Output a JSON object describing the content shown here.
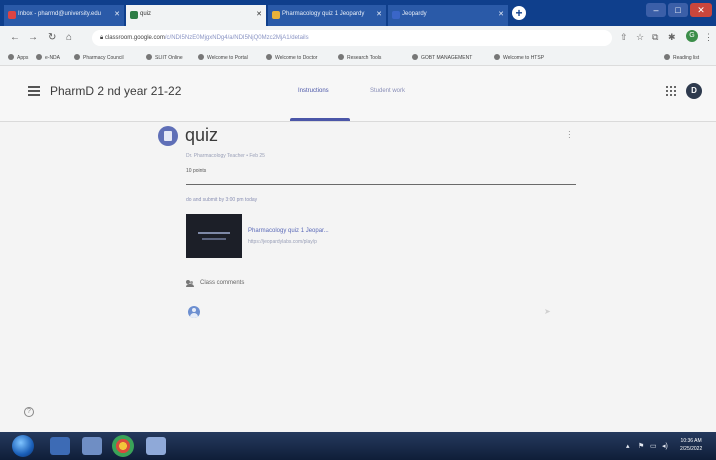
{
  "browser": {
    "tabs": [
      {
        "label": "Inbox - pharmd@university.edu",
        "active": false
      },
      {
        "label": "quiz",
        "active": true
      },
      {
        "label": "Pharmacology quiz 1 Jeopardy",
        "active": false
      },
      {
        "label": "Jeopardy",
        "active": false
      }
    ],
    "url": "classroom.google.com",
    "url_rest": "/c/NDI5NzE0MjgxNDg4/a/NDI5NjQ0Mzc2MjA1/details",
    "bookmarks": [
      "Apps",
      "e-NDA",
      "Pharmacy Council",
      "SLIIT Online",
      "Welcome to Portal",
      "Welcome to Doctor",
      "Research Tools",
      "GOBT MANAGEMENT",
      "Welcome to HTSP"
    ],
    "reading_list": "Reading list",
    "profile_initial": "G"
  },
  "classroom": {
    "class_name": "PharmD 2 nd year 21-22",
    "tabs": {
      "instructions": "Instructions",
      "student_work": "Student work"
    },
    "account_initial": "D"
  },
  "assignment": {
    "title": "quiz",
    "meta": "Dr. Pharmacology Teacher  •  Feb 25",
    "points": "10 points",
    "instructions": "do and submit by 3:00 pm today",
    "attachment_title": "Pharmacology quiz 1 Jeopar...",
    "attachment_url": "https://jeopardylabs.com/play/p",
    "comments_label": "Class comments"
  },
  "taskbar": {
    "time": "10:36 AM",
    "date": "2/25/2022"
  }
}
